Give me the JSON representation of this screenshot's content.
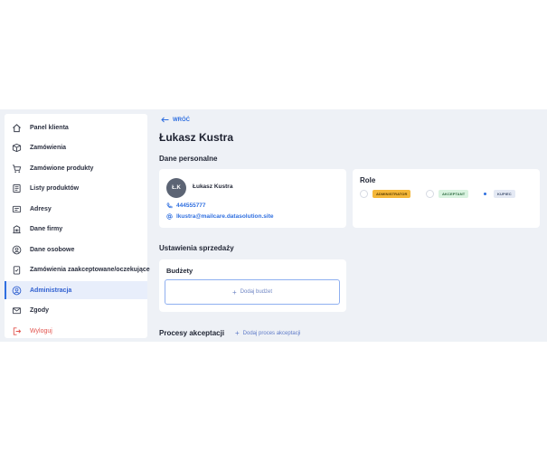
{
  "sidebar": {
    "items": [
      {
        "label": "Panel klienta"
      },
      {
        "label": "Zamówienia"
      },
      {
        "label": "Zamówione produkty"
      },
      {
        "label": "Listy produktów"
      },
      {
        "label": "Adresy"
      },
      {
        "label": "Dane firmy"
      },
      {
        "label": "Dane osobowe"
      },
      {
        "label": "Zamówienia zaakceptowane/oczekujące"
      },
      {
        "label": "Administracja",
        "active": true
      },
      {
        "label": "Zgody"
      },
      {
        "label": "Wyloguj"
      }
    ]
  },
  "main": {
    "back_label": "WRÓĆ",
    "title": "Łukasz Kustra",
    "personal": {
      "section_title": "Dane personalne",
      "initials": "Ł.K",
      "name": "Łukasz Kustra",
      "phone": "444555777",
      "email": "lkustra@mailcare.datasolution.site"
    },
    "roles": {
      "title": "Role",
      "items": [
        {
          "label": "ADMINISTRATOR",
          "selected": false,
          "color": "#f4b73a"
        },
        {
          "label": "AKCEPTANT",
          "selected": false,
          "color": "#d9f3e0"
        },
        {
          "label": "KUPIEC",
          "selected": true,
          "color": "#e4e9f4"
        }
      ]
    },
    "sales": {
      "section_title": "Ustawienia sprzedaży",
      "budgets_title": "Budżety",
      "add_budget_label": "Dodaj budżet"
    },
    "processes": {
      "section_title": "Procesy akceptacji",
      "add_label": "Dodaj proces akceptacji"
    }
  },
  "colors": {
    "accent": "#2f6fe0",
    "background": "#eef1f6",
    "logout": "#e2554f"
  }
}
